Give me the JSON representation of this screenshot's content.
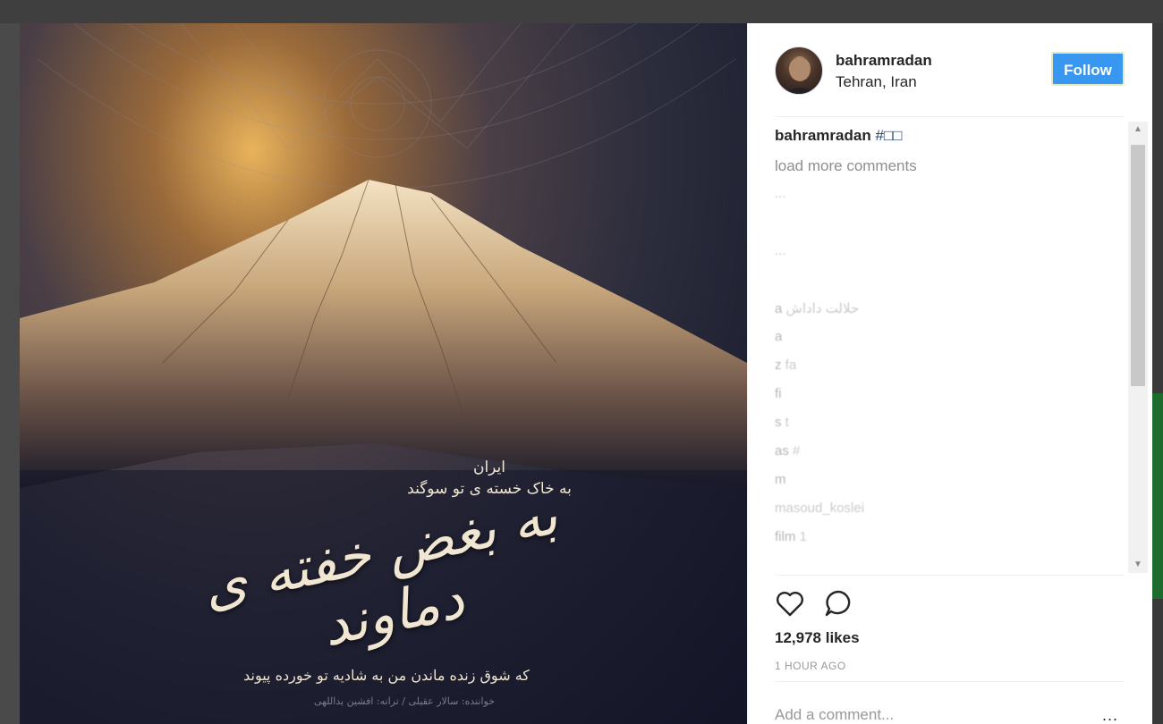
{
  "post": {
    "username": "bahramradan",
    "location": "Tehran, Iran",
    "follow_label": "Follow",
    "caption_user": "bahramradan",
    "caption_text": "#□□",
    "load_more": "load more comments",
    "likes": "12,978 likes",
    "time": "1 HOUR AGO",
    "add_comment_placeholder": "Add a comment...",
    "more_options": "..."
  },
  "photo": {
    "text_small_1": "ایران",
    "text_small_2": "به خاک خسته ی تو سوگند",
    "text_big": "به بغض خفته ی دماوند",
    "text_line": "که شوق زنده ماندن من به شادیه تو خورده پیوند",
    "text_credit": "خواننده: سالار عقیلی / ترانه: افشین یداللهی"
  },
  "comments": [
    {
      "user": "",
      "text": "..."
    },
    {
      "user": "",
      "text": ""
    },
    {
      "user": "",
      "text": "..."
    },
    {
      "user": "",
      "text": ""
    },
    {
      "user": "a",
      "text": "حلالت داداش"
    },
    {
      "user": "a",
      "text": ""
    },
    {
      "user": "z",
      "text": "fa"
    },
    {
      "user": "fi",
      "text": ""
    },
    {
      "user": "s",
      "text": "t"
    },
    {
      "user": "as",
      "text": "#"
    },
    {
      "user": "m",
      "text": ""
    },
    {
      "user": "",
      "text": "masoud_koslei"
    },
    {
      "user": "film",
      "text": "1"
    }
  ]
}
